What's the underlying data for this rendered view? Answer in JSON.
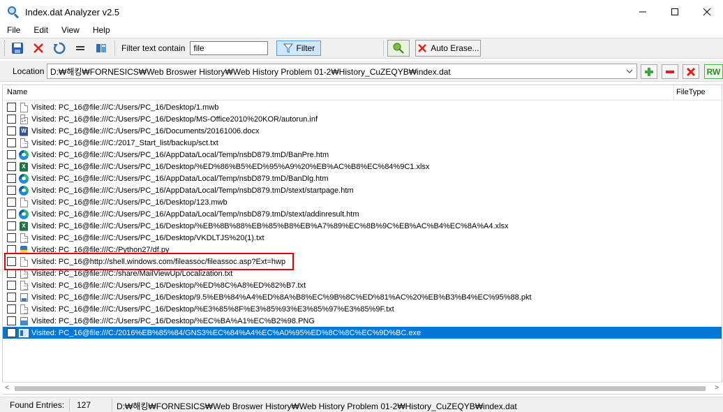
{
  "window": {
    "title": "Index.dat Analyzer v2.5",
    "controls": {
      "minimize": "—",
      "maximize": "☐",
      "close": "✕"
    }
  },
  "menu": [
    "File",
    "Edit",
    "View",
    "Help"
  ],
  "toolbar": {
    "filter_label": "Filter text contain",
    "filter_value": "file",
    "filter_button": "Filter",
    "auto_erase_button": "Auto Erase..."
  },
  "location": {
    "label": "Location",
    "path": "D:₩해킹₩FORNESICS₩Web Broswer History₩Web History Problem 01-2₩History_CuZEQYB₩index.dat",
    "rw_label": "RW"
  },
  "list": {
    "columns": [
      "Name",
      "FileType"
    ],
    "rows": [
      {
        "text": "Visited: PC_16@file:///C:/Users/PC_16/Desktop/1.mwb",
        "icon": "document-icon"
      },
      {
        "text": "Visited: PC_16@file:///C:/Users/PC_16/Desktop/MS-Office2010%20KOR/autorun.inf",
        "icon": "settings-file-icon"
      },
      {
        "text": "Visited: PC_16@file:///C:/Users/PC_16/Documents/20161006.docx",
        "icon": "word-icon"
      },
      {
        "text": "Visited: PC_16@file:///C:/2017_Start_list/backup/sct.txt",
        "icon": "text-file-icon"
      },
      {
        "text": "Visited: PC_16@file:///C:/Users/PC_16/AppData/Local/Temp/nsbD879.tmD/BanPre.htm",
        "icon": "edge-icon"
      },
      {
        "text": "Visited: PC_16@file:///C:/Users/PC_16/Desktop/%ED%86%B5%ED%95%A9%20%EB%AC%B8%EC%84%9C1.xlsx",
        "icon": "excel-icon"
      },
      {
        "text": "Visited: PC_16@file:///C:/Users/PC_16/AppData/Local/Temp/nsbD879.tmD/BanDlg.htm",
        "icon": "edge-icon"
      },
      {
        "text": "Visited: PC_16@file:///C:/Users/PC_16/AppData/Local/Temp/nsbD879.tmD/stext/startpage.htm",
        "icon": "edge-icon"
      },
      {
        "text": "Visited: PC_16@file:///C:/Users/PC_16/Desktop/123.mwb",
        "icon": "document-icon"
      },
      {
        "text": "Visited: PC_16@file:///C:/Users/PC_16/AppData/Local/Temp/nsbD879.tmD/stext/addinresult.htm",
        "icon": "edge-icon"
      },
      {
        "text": "Visited: PC_16@file:///C:/Users/PC_16/Desktop/%EB%8B%88%EB%85%B8%EB%A7%89%EC%8B%9C%EB%AC%B4%EC%8A%A4.xlsx",
        "icon": "excel-icon"
      },
      {
        "text": "Visited: PC_16@file:///C:/Users/PC_16/Desktop/VKDLTJS%20(1).txt",
        "icon": "text-file-icon"
      },
      {
        "text": "Visited: PC_16@file:///C:/Python27/df.py",
        "icon": "python-icon"
      },
      {
        "text": "Visited: PC_16@http://shell.windows.com/fileassoc/fileassoc.asp?Ext=hwp",
        "icon": "document-icon"
      },
      {
        "text": "Visited: PC_16@file:///C:/share/MailViewUp/Localization.txt",
        "icon": "text-file-icon"
      },
      {
        "text": "Visited: PC_16@file:///C:/Users/PC_16/Desktop/%ED%8C%A8%ED%82%B7.txt",
        "icon": "text-file-icon"
      },
      {
        "text": "Visited: PC_16@file:///C:/Users/PC_16/Desktop/9.5%EB%84%A4%ED%8A%B8%EC%9B%8C%ED%81%AC%20%EB%B3%B4%EC%95%88.pkt",
        "icon": "packet-file-icon"
      },
      {
        "text": "Visited: PC_16@file:///C:/Users/PC_16/Desktop/%E3%85%8F%E3%85%93%E3%85%97%E3%85%9F.txt",
        "icon": "text-file-icon"
      },
      {
        "text": "Visited: PC_16@file:///C:/Users/PC_16/Desktop/%EC%BA%A1%EC%B2%98.PNG",
        "icon": "image-icon"
      },
      {
        "text": "Visited: PC_16@file:///C:/2016%EB%85%84/GNS3%EC%84%A4%EC%A0%95%ED%8C%8C%EC%9D%BC.exe",
        "icon": "exe-icon"
      }
    ],
    "selected_index": 19,
    "highlighted_index": 13
  },
  "scroll": {
    "left": "<",
    "right": ">"
  },
  "status": {
    "found_label": "Found Entries:",
    "found_count": "127",
    "path": "D:₩해킹₩FORNESICS₩Web Broswer History₩Web History Problem 01-2₩History_CuZEQYB₩index.dat"
  }
}
